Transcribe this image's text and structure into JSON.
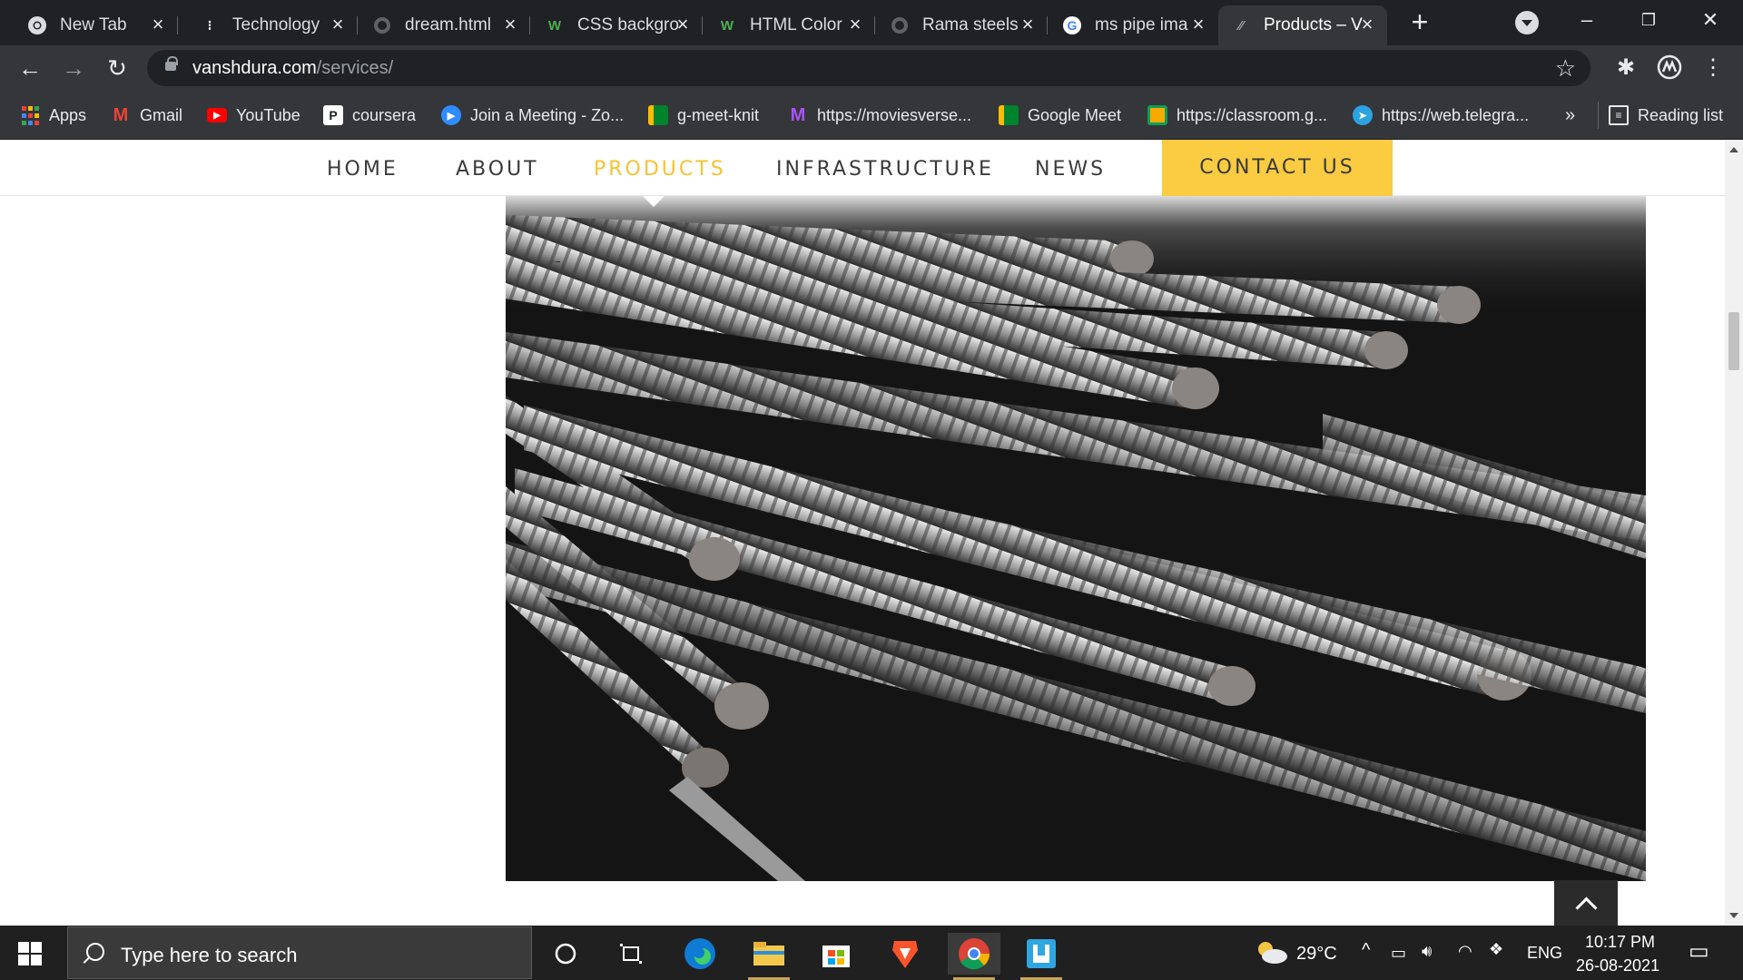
{
  "browser": {
    "tabs": [
      {
        "title": "New Tab",
        "icon": "chrome-icon"
      },
      {
        "title": "Technology",
        "icon": "stripe-icon"
      },
      {
        "title": "dream.html",
        "icon": "globe-icon"
      },
      {
        "title": "CSS backgro",
        "icon": "w3schools-icon"
      },
      {
        "title": "HTML Color",
        "icon": "w3schools-icon"
      },
      {
        "title": "Rama steels",
        "icon": "globe-icon"
      },
      {
        "title": "ms pipe ima",
        "icon": "google-icon"
      },
      {
        "title": "Products – V",
        "icon": "site-icon"
      }
    ],
    "url_domain": "vanshdura.com",
    "url_path": "/services/",
    "bookmarks": [
      {
        "label": "Apps",
        "icon": "apps-icon"
      },
      {
        "label": "Gmail",
        "icon": "gmail-icon"
      },
      {
        "label": "YouTube",
        "icon": "youtube-icon"
      },
      {
        "label": "coursera",
        "icon": "coursera-icon"
      },
      {
        "label": "Join a Meeting - Zo...",
        "icon": "zoom-icon"
      },
      {
        "label": "g-meet-knit",
        "icon": "meet-icon"
      },
      {
        "label": "https://moviesverse...",
        "icon": "m-icon"
      },
      {
        "label": "Google Meet",
        "icon": "meet-icon"
      },
      {
        "label": "https://classroom.g...",
        "icon": "classroom-icon"
      },
      {
        "label": "https://web.telegra...",
        "icon": "telegram-icon"
      }
    ],
    "overflow_label": "»",
    "reading_list": "Reading list"
  },
  "site": {
    "nav": {
      "home": "HOME",
      "about": "ABOUT",
      "products": "PRODUCTS",
      "infrastructure": "INFRASTRUCTURE",
      "news": "NEWS",
      "contact": "CONTACT US"
    },
    "accent_color": "#fbcb42",
    "active_color": "#f7c335"
  },
  "taskbar": {
    "search_placeholder": "Type here to search",
    "temperature": "29°C",
    "language": "ENG",
    "time": "10:17 PM",
    "date": "26-08-2021"
  }
}
